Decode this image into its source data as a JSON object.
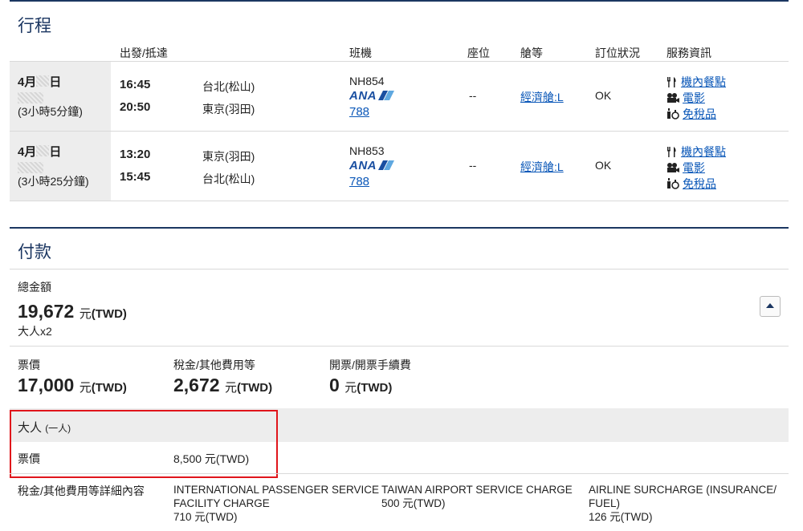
{
  "itinerary": {
    "title": "行程",
    "headers": {
      "depart_arrive": "出發/抵達",
      "flight": "班機",
      "seat": "座位",
      "cabin": "艙等",
      "status": "訂位狀況",
      "services": "服務資訊"
    },
    "rows": [
      {
        "date_month": "4月",
        "date_day": "日",
        "duration": "(3小時5分鐘)",
        "depart_time": "16:45",
        "arrive_time": "20:50",
        "depart_city": "台北(松山)",
        "arrive_city": "東京(羽田)",
        "flight_no": "NH854",
        "airline_logo": "ANA",
        "equipment": "788",
        "seat": "--",
        "cabin": "經濟艙:L",
        "status": "OK",
        "services": [
          "機內餐點",
          "電影",
          "免稅品"
        ]
      },
      {
        "date_month": "4月",
        "date_day": "日",
        "duration": "(3小時25分鐘)",
        "depart_time": "13:20",
        "arrive_time": "15:45",
        "depart_city": "東京(羽田)",
        "arrive_city": "台北(松山)",
        "flight_no": "NH853",
        "airline_logo": "ANA",
        "equipment": "788",
        "seat": "--",
        "cabin": "經濟艙:L",
        "status": "OK",
        "services": [
          "機內餐點",
          "電影",
          "免稅品"
        ]
      }
    ],
    "service_icons": [
      "fork-knife-icon",
      "film-reel-icon",
      "duty-free-icon"
    ]
  },
  "payment": {
    "title": "付款",
    "total_label": "總金額",
    "total_amount": "19,672",
    "unit_yuan": "元",
    "currency": "(TWD)",
    "passengers": "大人x2",
    "fare_label": "票價",
    "fare_amount": "17,000",
    "tax_label": "稅金/其他費用等",
    "tax_amount": "2,672",
    "ticketing_label": "開票/開票手續費",
    "ticketing_amount": "0",
    "adult_label": "大人",
    "adult_count": "(一人)",
    "adult_fare_label": "票價",
    "adult_fare_value": "8,500 元(TWD)",
    "tax_detail_label": "稅金/其他費用等詳細內容",
    "tax_items": [
      {
        "name_line1": "INTERNATIONAL PASSENGER SERVICE",
        "name_line2": "FACILITY CHARGE",
        "amount": "710 元(TWD)"
      },
      {
        "name_line1": "TAIWAN AIRPORT SERVICE CHARGE",
        "name_line2": "",
        "amount": "500 元(TWD)"
      },
      {
        "name_line1": "AIRLINE SURCHARGE (INSURANCE/",
        "name_line2": "FUEL)",
        "amount": "126 元(TWD)"
      }
    ]
  },
  "colors": {
    "heading": "#1b3661",
    "link": "#0a57b8",
    "highlight_box": "#e0151b",
    "band": "#ededed"
  }
}
